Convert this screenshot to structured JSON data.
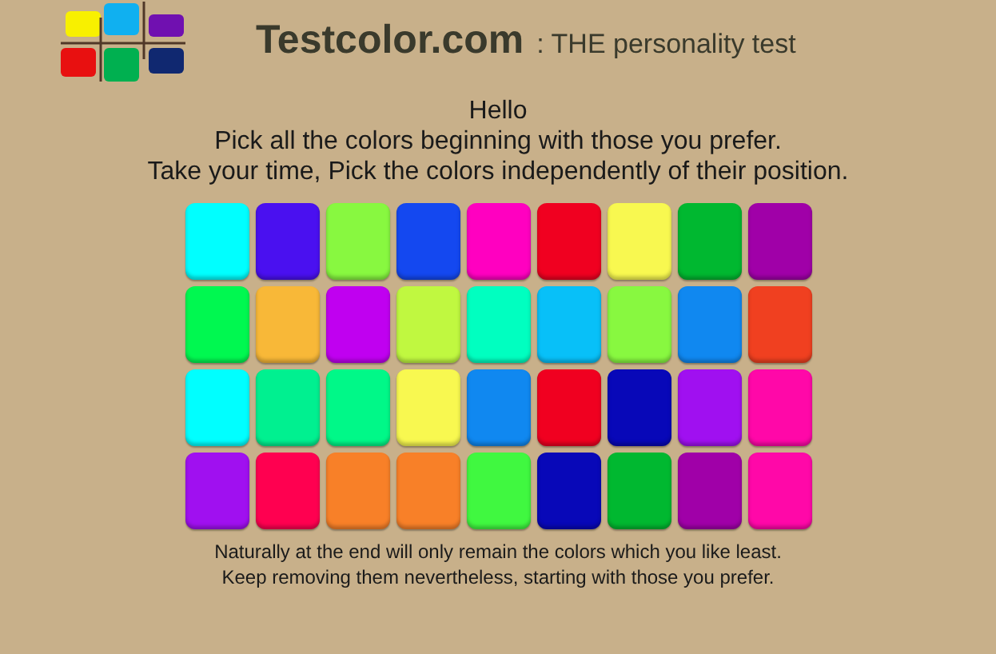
{
  "header": {
    "site_name": "Testcolor.com",
    "tagline": ": THE personality test"
  },
  "intro": [
    "Hello",
    "Pick all the colors beginning with those you prefer.",
    "Take your time, Pick the colors independently of their position."
  ],
  "tiles": [
    [
      {
        "color": "#00ffff"
      },
      {
        "color": "#4a10f0"
      },
      {
        "color": "#88f840"
      },
      {
        "color": "#1448f0"
      },
      {
        "color": "#ff00c0"
      },
      {
        "color": "#f00020"
      },
      {
        "color": "#f8f850"
      },
      {
        "color": "#00b830"
      },
      {
        "color": "#a000a8"
      }
    ],
    [
      {
        "color": "#00f850"
      },
      {
        "color": "#f8b838"
      },
      {
        "color": "#c000f0"
      },
      {
        "color": "#c0f840"
      },
      {
        "color": "#00ffc0"
      },
      {
        "color": "#08c0f8"
      },
      {
        "color": "#88f840"
      },
      {
        "color": "#1088f0"
      },
      {
        "color": "#f04020"
      }
    ],
    [
      {
        "color": "#00ffff"
      },
      {
        "color": "#00f090"
      },
      {
        "color": "#00f888"
      },
      {
        "color": "#f8f850"
      },
      {
        "color": "#1088f0"
      },
      {
        "color": "#f00020"
      },
      {
        "color": "#0808b8"
      },
      {
        "color": "#a010f0"
      },
      {
        "color": "#ff08a8"
      }
    ],
    [
      {
        "color": "#a010f0"
      },
      {
        "color": "#ff0050"
      },
      {
        "color": "#f88028"
      },
      {
        "color": "#f88028"
      },
      {
        "color": "#40f840"
      },
      {
        "color": "#0808b8"
      },
      {
        "color": "#00b830"
      },
      {
        "color": "#a000a8"
      },
      {
        "color": "#ff08a8"
      }
    ]
  ],
  "footer": [
    "Naturally at the end will only remain the colors which you like least.",
    "Keep removing them nevertheless, starting with those you prefer."
  ]
}
